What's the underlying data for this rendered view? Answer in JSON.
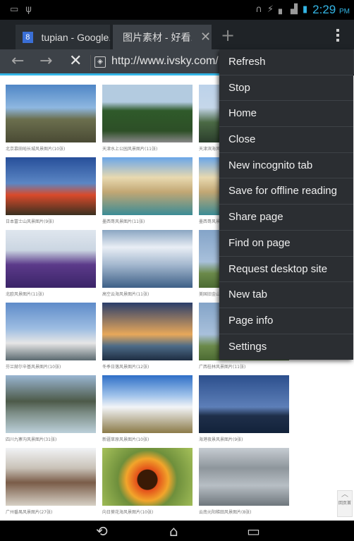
{
  "status_bar": {
    "time": "2:29",
    "ampm": "PM",
    "icons": [
      "screenshot-icon",
      "usb-icon",
      "headphones-icon",
      "mute-icon",
      "wifi-icon",
      "signal-icon",
      "battery-icon"
    ]
  },
  "tabs": [
    {
      "title": "tupian - Google...",
      "favicon": "8"
    },
    {
      "title": "图片素材 - 好看...",
      "active": true
    }
  ],
  "url_bar": {
    "url": "http://www.ivsky.com/"
  },
  "menu": {
    "items": [
      "Refresh",
      "Stop",
      "Home",
      "Close",
      "New incognito tab",
      "Save for offline reading",
      "Share page",
      "Find on page",
      "Request desktop site",
      "New tab",
      "Page info",
      "Settings"
    ]
  },
  "gallery": {
    "captions": [
      "北京慕田峪长城风景图片(10张)",
      "天津水上公园风景图片(11张)",
      "天津滨海风景图片(10张)",
      "日本富士山风景图片(9张)",
      "墨西哥风景图片(11张)",
      "墨西哥风景图片(11张)",
      "北欧风景图片(11张)",
      "高空云海风景图片(11张)",
      "美国旧金山风景图片(11张)",
      "芬兰赫尔辛基风景图片(10张)",
      "冬季日落风景图片(12张)",
      "广西桂林风景图片(11张)",
      "四川九寨沟风景图片(31张)",
      "新疆草原风景图片(10张)",
      "海港夜景风景图片(9张)",
      "广州番禺风景图片(27张)",
      "向日葵花海风景图片(10张)",
      "云南元阳梯田风景图片(8张)"
    ]
  },
  "scroll_top": {
    "label": "回页首"
  }
}
